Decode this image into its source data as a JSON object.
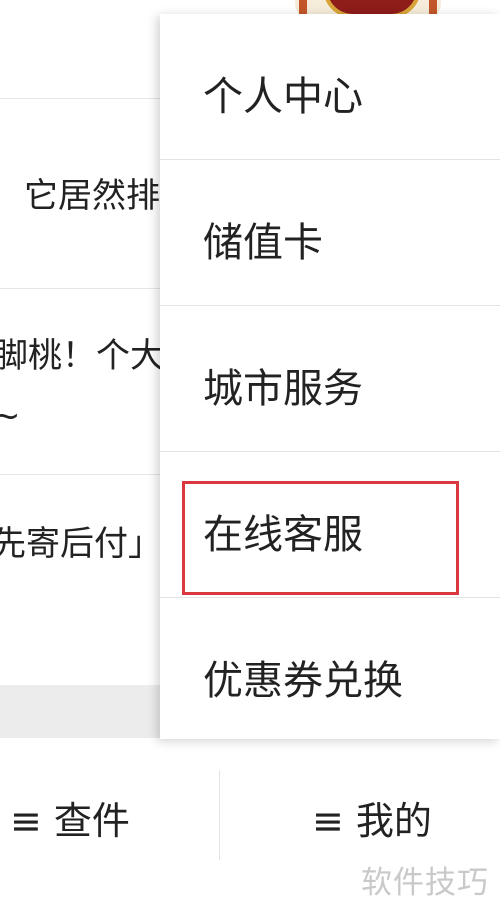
{
  "background_list": {
    "rows": [
      {
        "text": "它居然排"
      },
      {
        "text": "脚桃！个大"
      },
      {
        "text": "~"
      },
      {
        "text": "先寄后付」"
      }
    ]
  },
  "bottom_nav": {
    "items": [
      {
        "label": "≡ 查件"
      },
      {
        "label": "≡ 我的"
      }
    ]
  },
  "dropdown_menu": {
    "items": [
      {
        "label": "个人中心"
      },
      {
        "label": "储值卡"
      },
      {
        "label": "城市服务"
      },
      {
        "label": "在线客服"
      },
      {
        "label": "优惠券兑换"
      }
    ],
    "highlighted_item": "在线客服",
    "highlight_color": "#d9383f"
  },
  "watermark": {
    "text": "软件技巧"
  },
  "colors": {
    "background": "#ffffff",
    "band": "#ececec",
    "text": "#222222",
    "watermark": "#c9c9c9"
  }
}
